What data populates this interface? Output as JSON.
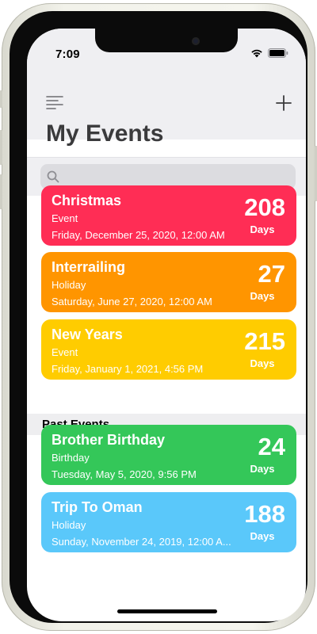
{
  "status_bar": {
    "time": "7:09"
  },
  "header": {
    "title": "My Events"
  },
  "search": {
    "placeholder": "",
    "value": ""
  },
  "events": [
    {
      "title": "Christmas",
      "category": "Event",
      "date": "Friday, December 25, 2020, 12:00 AM",
      "count": "208",
      "unit": "Days",
      "color": "#ff2d55"
    },
    {
      "title": "Interrailing",
      "category": "Holiday",
      "date": "Saturday, June 27, 2020, 12:00 AM",
      "count": "27",
      "unit": "Days",
      "color": "#ff9500"
    },
    {
      "title": "New Years",
      "category": "Event",
      "date": "Friday, January 1, 2021, 4:56 PM",
      "count": "215",
      "unit": "Days",
      "color": "#ffcc00"
    }
  ],
  "past_section": {
    "label": "Past Events"
  },
  "past_events": [
    {
      "title": "Brother Birthday",
      "category": "Birthday",
      "date": "Tuesday, May 5, 2020, 9:56 PM",
      "count": "24",
      "unit": "Days",
      "color": "#34c759"
    },
    {
      "title": "Trip To Oman",
      "category": "Holiday",
      "date": "Sunday, November 24, 2019, 12:00 A...",
      "count": "188",
      "unit": "Days",
      "color": "#5ac8fa"
    }
  ]
}
